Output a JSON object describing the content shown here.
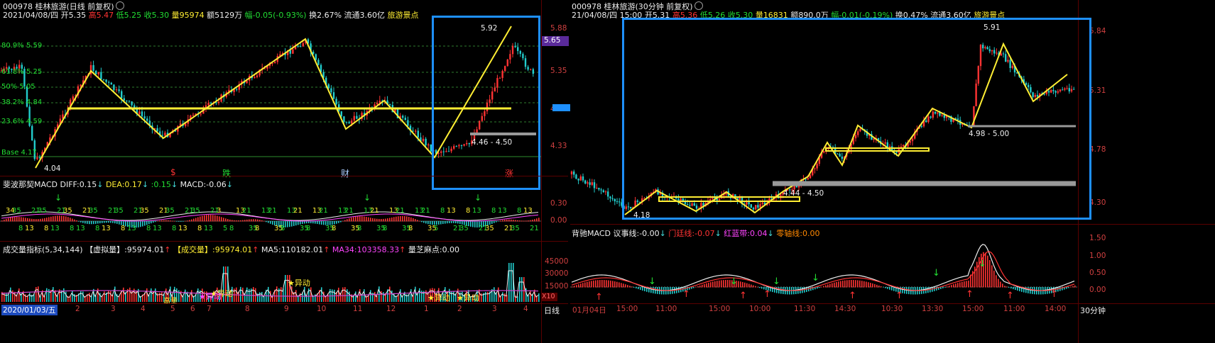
{
  "left": {
    "title": "000978 桂林旅游(日线 前复权)",
    "info": {
      "date": "2021/04/08/四",
      "open_label": "开",
      "open": "5.35",
      "high_label": "高",
      "high": "5.47",
      "low_label": "低",
      "low": "5.25",
      "close_label": "收",
      "close": "5.30",
      "vol_label": "量",
      "vol": "95974",
      "amount_label": "额",
      "amount": "5129万",
      "range_label": "幅",
      "range": "-0.05(-0.93%)",
      "turnover_label": "换",
      "turnover": "2.67%",
      "float_label": "流通",
      "float": "3.60亿",
      "sector": "旅游景点"
    },
    "price_axis": [
      "5.88",
      "5.35",
      "4.87",
      "4.33"
    ],
    "current_price": "5.65",
    "fib_levels": [
      "80.9% 5.59",
      "61.8% 5.25",
      "50% 5.05",
      "38.2% 4.84",
      "23.6% 4.59",
      "Base 4.17"
    ],
    "annotations": {
      "high": "5.92",
      "low": "4.04",
      "zone": "4.46 - 4.50"
    },
    "events": [
      "$",
      "跌",
      "财",
      "涨"
    ],
    "macd_header": {
      "name": "斐波那契MACD",
      "diff_label": "DIFF:",
      "diff": "0.15",
      "dea_label": "DEA:",
      "dea": "0.17",
      "hist_label": ":",
      "hist": "0.15",
      "macd_label": "MACD:",
      "macd": "-0.06"
    },
    "macd_axis": [
      "0.30",
      "0.00"
    ],
    "fib_numbers": [
      "34",
      "35",
      "8",
      "13",
      "21",
      "35",
      "8",
      "13",
      "21",
      "35",
      "8",
      "13",
      "21",
      "35",
      "8",
      "13",
      "21",
      "35",
      "8",
      "13",
      "21",
      "35",
      "8",
      "13",
      "21",
      "35",
      "8",
      "13",
      "21",
      "35",
      "8",
      "13",
      "21",
      "3",
      "5",
      "8",
      "13",
      "21",
      "35",
      "8",
      "13",
      "21",
      "35",
      "8",
      "13",
      "21",
      "35",
      "8",
      "13",
      "21",
      "35",
      "8",
      "13",
      "21",
      "35",
      "8",
      "13",
      "21",
      "35",
      "8",
      "13",
      "21",
      "35",
      "8",
      "13",
      "21",
      "35",
      "5",
      "8",
      "13",
      "21",
      "35",
      "8",
      "13",
      "21",
      "35",
      "8",
      "13",
      "21",
      "35",
      "8",
      "13",
      "21"
    ],
    "vol_header": {
      "name": "成交量指标(5,34,144)",
      "virt_label": "【虚拟量】:",
      "virt": "95974.01",
      "real_label": "【成交量】:",
      "real": "95974.01",
      "ma5_label": "MA5:",
      "ma5": "110182.01",
      "ma34_label": "MA34:",
      "ma34": "103358.33",
      "sesame_label": "量芝麻点:",
      "sesame": "0.00"
    },
    "vol_axis": [
      "45000",
      "30000",
      "15000"
    ],
    "vol_unit": "X10",
    "vol_tags": [
      "异动",
      "异动",
      "异动",
      "异动",
      "高量",
      "异动"
    ],
    "time_axis": [
      "2020/01/03/五",
      "2",
      "3",
      "4",
      "5",
      "6",
      "7",
      "8",
      "9",
      "10",
      "11",
      "12",
      "1",
      "2",
      "3",
      "4"
    ],
    "period": "日线"
  },
  "right": {
    "title": "000978 桂林旅游(30分钟 前复权)",
    "info": {
      "date": "21/04/08/四 15:00",
      "open_label": "开",
      "open": "5.31",
      "high_label": "高",
      "high": "5.36",
      "low_label": "低",
      "low": "5.26",
      "close_label": "收",
      "close": "5.30",
      "vol_label": "量",
      "vol": "16831",
      "amount_label": "额",
      "amount": "890.0万",
      "range_label": "幅",
      "range": "-0.01(-0.19%)",
      "turnover_label": "换",
      "turnover": "0.47%",
      "float_label": "流通",
      "float": "3.60亿",
      "sector": "旅游景点"
    },
    "price_axis": [
      "5.84",
      "5.31",
      "4.78",
      "4.30"
    ],
    "annotations": {
      "high": "5.91",
      "low": "4.18",
      "zone1": "4.98 - 5.00",
      "zone2": "4.44 - 4.50"
    },
    "macd_header": {
      "name": "背驰MACD",
      "a_label": "议事线:",
      "a": "-0.00",
      "b_label": "门廷线:",
      "b": "-0.07",
      "c_label": "红蓝带:",
      "c": "0.04",
      "d_label": "零轴线:",
      "d": "0.00"
    },
    "macd_axis": [
      "1.50",
      "1.00",
      "0.50",
      "0.00"
    ],
    "time_axis": [
      "01月04日",
      "15:00",
      "11:00",
      "15:00",
      "10:00",
      "11:30",
      "14:30",
      "10:30",
      "13:30",
      "15:00",
      "11:00",
      "14:00"
    ],
    "period": "30分钟"
  },
  "colors": {
    "up": "#ff3333",
    "down": "#22cccc",
    "highlight": "#1e90ff",
    "fib": "#ffee33"
  }
}
